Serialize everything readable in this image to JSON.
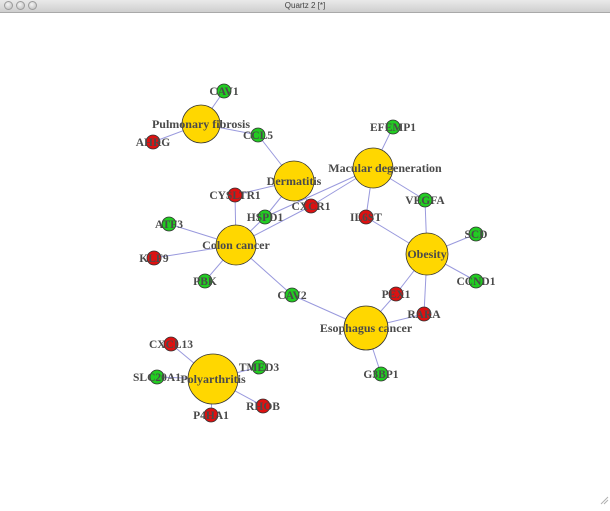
{
  "window": {
    "title": "Quartz 2 [*]",
    "buttons": [
      "close",
      "minimize",
      "zoom"
    ]
  },
  "colors": {
    "disease": "#FFD700",
    "up_gene": "#22CC22",
    "down_gene": "#DD1111",
    "edge": "#9999DD",
    "label": "#4A4A4A"
  },
  "network": {
    "diseases": [
      {
        "id": "pf",
        "label": "Pulmonary fibrosis"
      },
      {
        "id": "derm",
        "label": "Dermatitis"
      },
      {
        "id": "macular",
        "label": "Macular degeneration"
      },
      {
        "id": "colon",
        "label": "Colon cancer"
      },
      {
        "id": "obesity",
        "label": "Obesity"
      },
      {
        "id": "esoph",
        "label": "Esophagus cancer"
      },
      {
        "id": "poly",
        "label": "Polyarthritis"
      }
    ],
    "genes": [
      {
        "id": "cav1",
        "label": "CAV1",
        "kind": "up"
      },
      {
        "id": "ahrg",
        "label": "AHRG",
        "kind": "down"
      },
      {
        "id": "ccl5",
        "label": "CCL5",
        "kind": "up"
      },
      {
        "id": "efemp1",
        "label": "EFEMP1",
        "kind": "up"
      },
      {
        "id": "cysltr1",
        "label": "CYSLTR1",
        "kind": "down"
      },
      {
        "id": "cxcr1",
        "label": "CXCR1",
        "kind": "down"
      },
      {
        "id": "hspd1",
        "label": "HSPD1",
        "kind": "up"
      },
      {
        "id": "il6st",
        "label": "IL6ST",
        "kind": "down"
      },
      {
        "id": "vegfa",
        "label": "VEGFA",
        "kind": "up"
      },
      {
        "id": "atf3",
        "label": "ATF3",
        "kind": "up"
      },
      {
        "id": "klf9",
        "label": "KLF9",
        "kind": "down"
      },
      {
        "id": "pbk",
        "label": "PBK",
        "kind": "up"
      },
      {
        "id": "cav2",
        "label": "CAV2",
        "kind": "up"
      },
      {
        "id": "scd",
        "label": "SCD",
        "kind": "up"
      },
      {
        "id": "ccnd1",
        "label": "CCND1",
        "kind": "up"
      },
      {
        "id": "pex1",
        "label": "PEX1",
        "kind": "down"
      },
      {
        "id": "rara",
        "label": "RARA",
        "kind": "down"
      },
      {
        "id": "g3bp1",
        "label": "G3BP1",
        "kind": "up"
      },
      {
        "id": "cxcl13",
        "label": "CXCL13",
        "kind": "down"
      },
      {
        "id": "slc20a1",
        "label": "SLC20A1",
        "kind": "up"
      },
      {
        "id": "tmed3",
        "label": "TMED3",
        "kind": "up"
      },
      {
        "id": "p4ha1",
        "label": "P4HA1",
        "kind": "down"
      },
      {
        "id": "rhob",
        "label": "RHOB",
        "kind": "down"
      }
    ],
    "edges": [
      [
        "pf",
        "cav1"
      ],
      [
        "pf",
        "ahrg"
      ],
      [
        "pf",
        "ccl5"
      ],
      [
        "derm",
        "ccl5"
      ],
      [
        "derm",
        "cysltr1"
      ],
      [
        "derm",
        "cxcr1"
      ],
      [
        "derm",
        "hspd1"
      ],
      [
        "macular",
        "efemp1"
      ],
      [
        "macular",
        "vegfa"
      ],
      [
        "macular",
        "il6st"
      ],
      [
        "macular",
        "cxcr1"
      ],
      [
        "macular",
        "hspd1"
      ],
      [
        "colon",
        "cysltr1"
      ],
      [
        "colon",
        "hspd1"
      ],
      [
        "colon",
        "atf3"
      ],
      [
        "colon",
        "klf9"
      ],
      [
        "colon",
        "pbk"
      ],
      [
        "colon",
        "cav2"
      ],
      [
        "colon",
        "cxcr1"
      ],
      [
        "obesity",
        "vegfa"
      ],
      [
        "obesity",
        "il6st"
      ],
      [
        "obesity",
        "scd"
      ],
      [
        "obesity",
        "ccnd1"
      ],
      [
        "obesity",
        "pex1"
      ],
      [
        "obesity",
        "rara"
      ],
      [
        "esoph",
        "cav2"
      ],
      [
        "esoph",
        "pex1"
      ],
      [
        "esoph",
        "rara"
      ],
      [
        "esoph",
        "g3bp1"
      ],
      [
        "poly",
        "cxcl13"
      ],
      [
        "poly",
        "slc20a1"
      ],
      [
        "poly",
        "tmed3"
      ],
      [
        "poly",
        "p4ha1"
      ],
      [
        "poly",
        "rhob"
      ]
    ]
  }
}
